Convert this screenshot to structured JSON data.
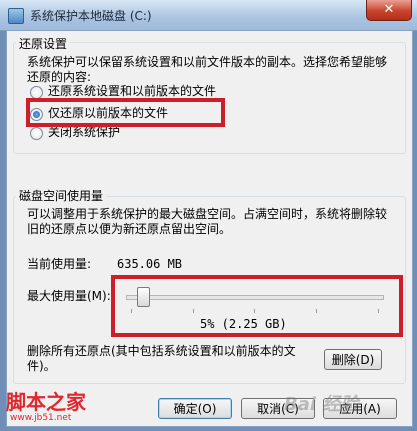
{
  "window": {
    "title": "系统保护本地磁盘 (C:)",
    "close_label": "✕"
  },
  "restore_settings": {
    "group_title": "还原设置",
    "description": "系统保护可以保留系统设置和以前文件版本的副本。选择您希望能够还原的内容:",
    "options": [
      {
        "label": "还原系统设置和以前版本的文件",
        "selected": false
      },
      {
        "label": "仅还原以前版本的文件",
        "selected": true
      },
      {
        "label": "关闭系统保护",
        "selected": false
      }
    ]
  },
  "disk_usage": {
    "group_title": "磁盘空间使用量",
    "description": "可以调整用于系统保护的最大磁盘空间。占满空间时，系统将删除较旧的还原点以便为新还原点留出空间。",
    "current_label": "当前使用量:",
    "current_value": "635.06 MB",
    "max_label": "最大使用量(M):",
    "slider_value_text": "5% (2.25 GB)",
    "slider_percent": 5
  },
  "delete_section": {
    "description": "删除所有还原点(其中包括系统设置和以前版本的文件)。",
    "delete_button": "删除(D)"
  },
  "buttons": {
    "ok": "确定(O)",
    "cancel": "取消(C)",
    "apply": "应用(A)"
  },
  "watermarks": {
    "logo": "脚本之家",
    "url": "www.jb51.net",
    "corner": "Bai 经验"
  },
  "colors": {
    "highlight": "#cc1f2b",
    "window_bg": "#f0f0f0"
  }
}
